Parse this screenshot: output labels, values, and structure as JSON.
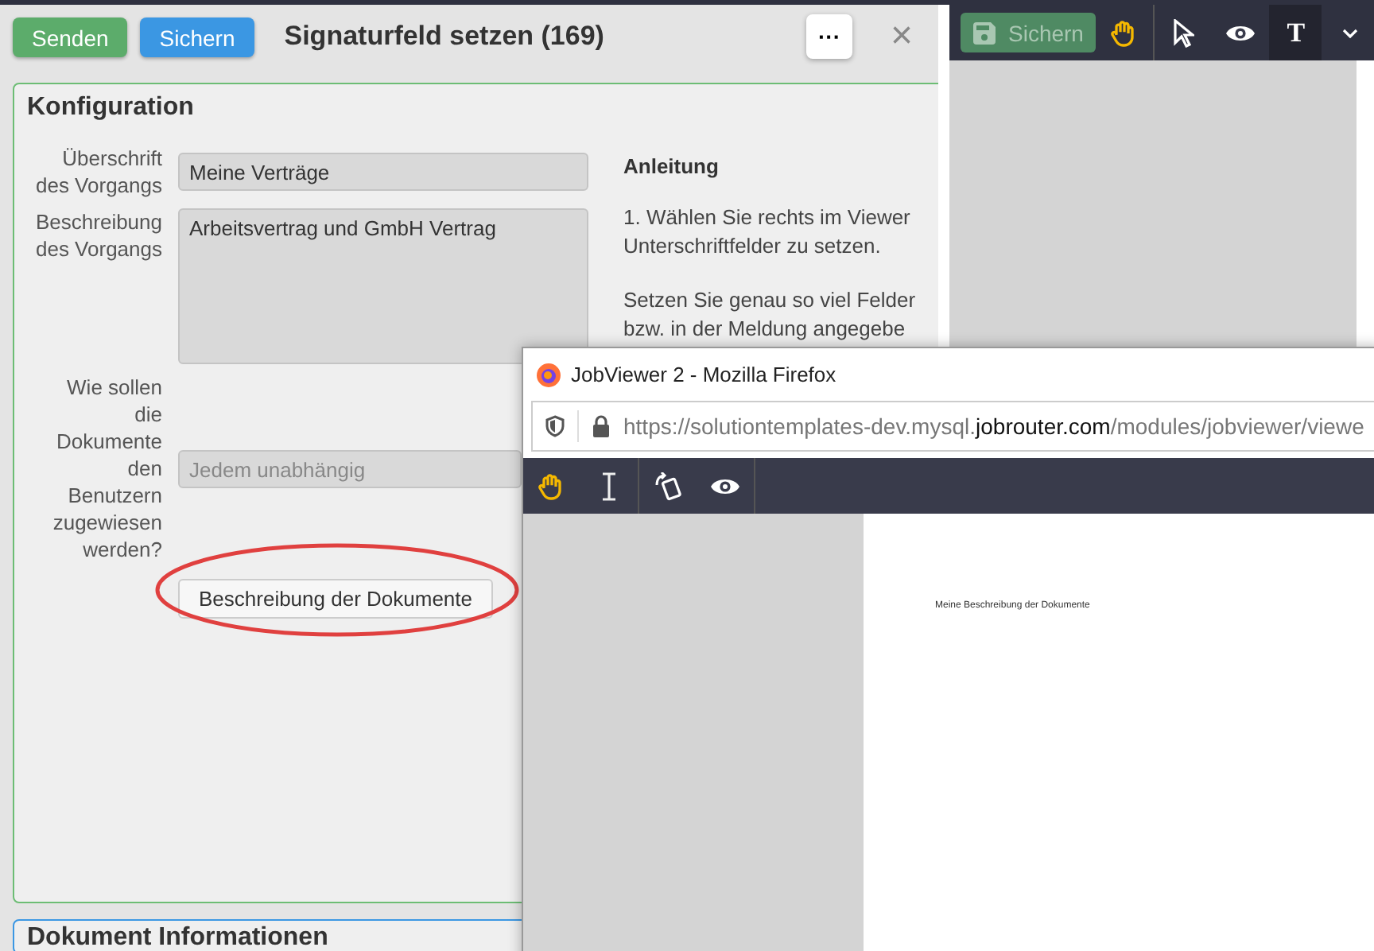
{
  "header": {
    "buttons": [
      {
        "label": "Senden",
        "kind": "green"
      },
      {
        "label": "Sichern",
        "kind": "blue"
      }
    ],
    "title": "Signaturfeld setzen (169)",
    "more": "···",
    "close": "×"
  },
  "config": {
    "title": "Konfiguration",
    "fields": [
      {
        "label": "Überschrift\ndes Vorgangs",
        "value": "Meine Verträge",
        "kind": "input",
        "disabled": false
      },
      {
        "label": "Beschreibung\ndes Vorgangs",
        "value": "Arbeitsvertrag und GmbH Vertrag",
        "kind": "textarea",
        "disabled": false
      },
      {
        "label": "Wie sollen\ndie\nDokumente\nden\nBenutzern\nzugewiesen\nwerden?",
        "value": "Jedem unabhängig",
        "kind": "select",
        "disabled": true
      }
    ],
    "button": "Beschreibung der Dokumente",
    "instructions": {
      "title": "Anleitung",
      "paragraphs": [
        "1. Wählen Sie rechts im Viewer\nUnterschriftfelder zu setzen.",
        "Setzen Sie genau so viel Felder\nbzw. in der Meldung angegebe"
      ]
    }
  },
  "next_section": {
    "title": "Dokument Informationen"
  },
  "viewer_toolbar": {
    "save": "Sichern",
    "save_disabled": true,
    "text_tool": "T"
  },
  "popup": {
    "title": "JobViewer 2 - Mozilla Firefox",
    "url_prefix": "https://solutiontemplates-dev.mysql.",
    "url_domain": "jobrouter.com",
    "url_rest": "/modules/jobviewer/viewe",
    "document_text": "Meine Beschreibung der Dokumente"
  }
}
